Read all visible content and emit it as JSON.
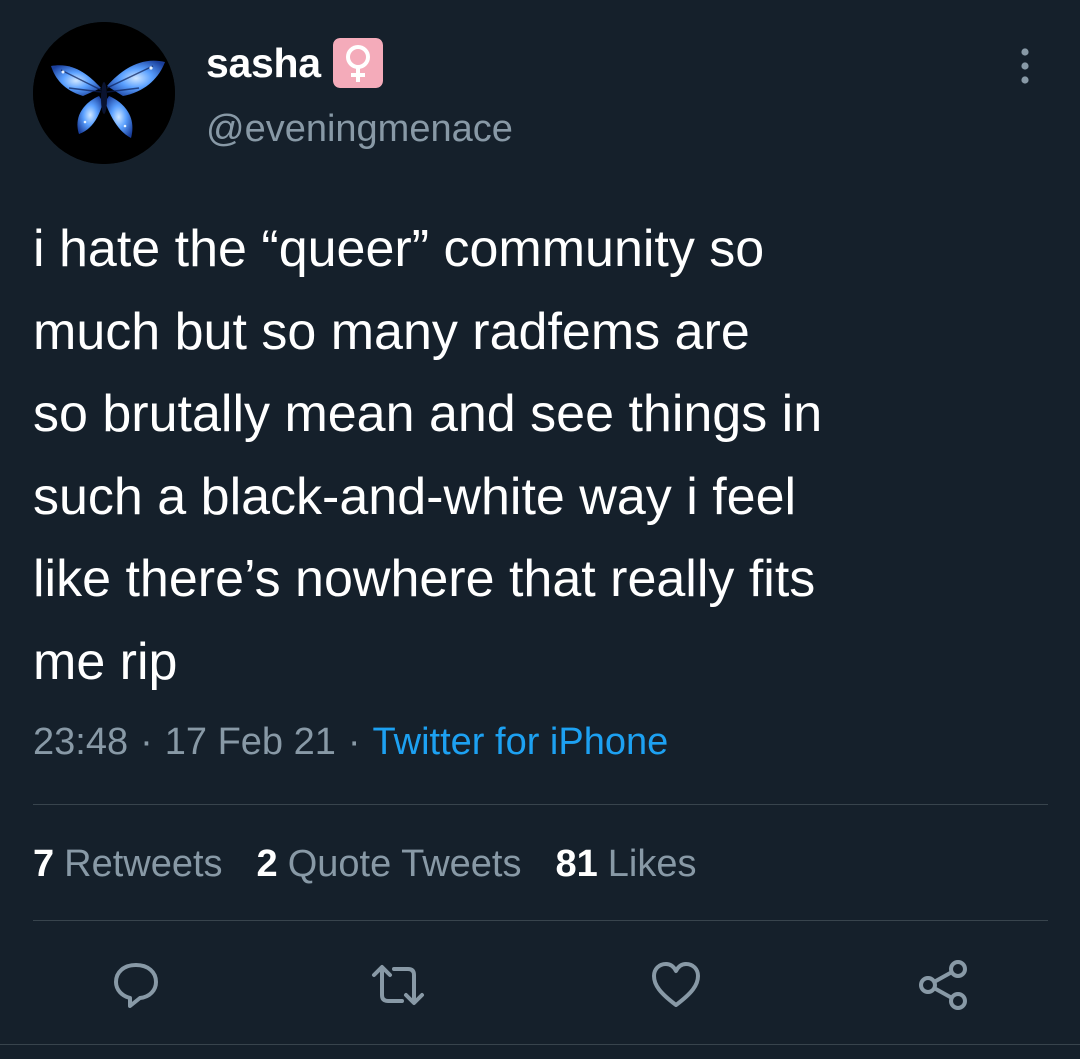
{
  "colors": {
    "background": "#15202b",
    "text_primary": "#ffffff",
    "text_secondary": "#8899a6",
    "link": "#1da1f2",
    "divider": "#38444d",
    "emoji_badge": "#f4abba"
  },
  "author": {
    "display_name": "sasha",
    "name_emoji": "female-sign-emoji",
    "handle": "@eveningmenace",
    "avatar": "blue-butterfly-avatar"
  },
  "tweet": {
    "text": "i hate the “queer” community so\nmuch but so many radfems are\nso brutally mean and see things in\nsuch a black-and-white way i feel\nlike there’s nowhere that really fits\nme rip",
    "time": "23:48",
    "date": "17 Feb 21",
    "separator": "·",
    "source": "Twitter for iPhone"
  },
  "stats": {
    "retweets_count": "7",
    "retweets_label": "Retweets",
    "quotes_count": "2",
    "quotes_label": "Quote Tweets",
    "likes_count": "81",
    "likes_label": "Likes"
  },
  "actions": [
    {
      "icon": "reply-icon"
    },
    {
      "icon": "retweet-icon"
    },
    {
      "icon": "like-icon"
    },
    {
      "icon": "share-icon"
    }
  ],
  "menu_icon": "more-vertical-icon"
}
